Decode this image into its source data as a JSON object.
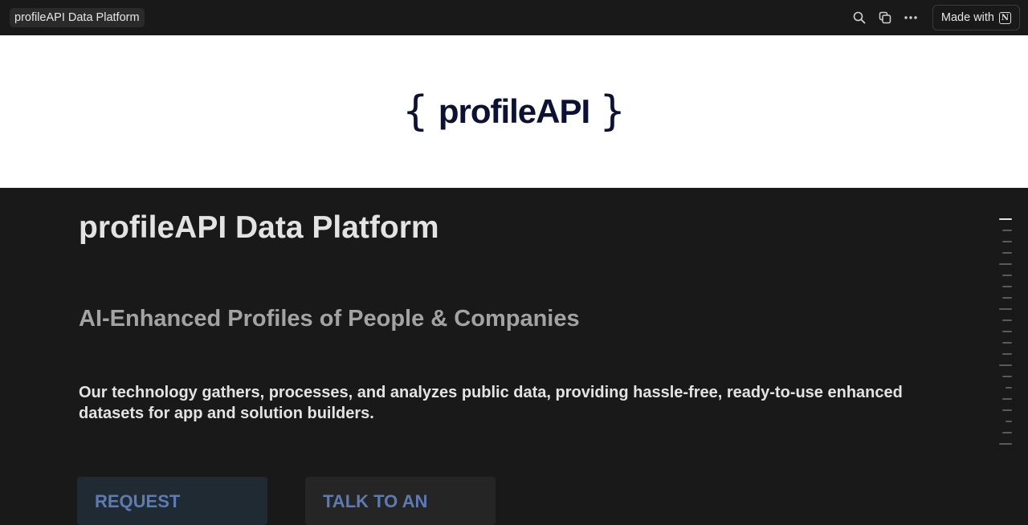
{
  "topbar": {
    "breadcrumb": "profileAPI Data Platform",
    "icons": [
      "search-icon",
      "duplicate-icon",
      "more-icon"
    ],
    "made_with_label": "Made with",
    "notion_glyph": "N"
  },
  "cover": {
    "logo_left_brace": "{",
    "logo_text": "profileAPI",
    "logo_right_brace": "}"
  },
  "page": {
    "title": "profileAPI Data Platform",
    "subtitle": "AI-Enhanced Profiles of People & Companies",
    "description": "Our technology gathers, processes, and analyzes public data, providing hassle-free, ready-to-use enhanced datasets for app and solution builders.",
    "cta_buttons": [
      {
        "label": "REQUEST"
      },
      {
        "label": "TALK TO AN"
      }
    ]
  },
  "toc": {
    "marks": [
      {
        "level": 1,
        "active": true
      },
      {
        "level": 2
      },
      {
        "level": 2
      },
      {
        "level": 2
      },
      {
        "level": 1
      },
      {
        "level": 2
      },
      {
        "level": 2
      },
      {
        "level": 2
      },
      {
        "level": 1
      },
      {
        "level": 2
      },
      {
        "level": 2
      },
      {
        "level": 2
      },
      {
        "level": 2
      },
      {
        "level": 1
      },
      {
        "level": 2
      },
      {
        "level": 3
      },
      {
        "level": 2
      },
      {
        "level": 2
      },
      {
        "level": 3
      },
      {
        "level": 2
      },
      {
        "level": 1
      }
    ]
  }
}
